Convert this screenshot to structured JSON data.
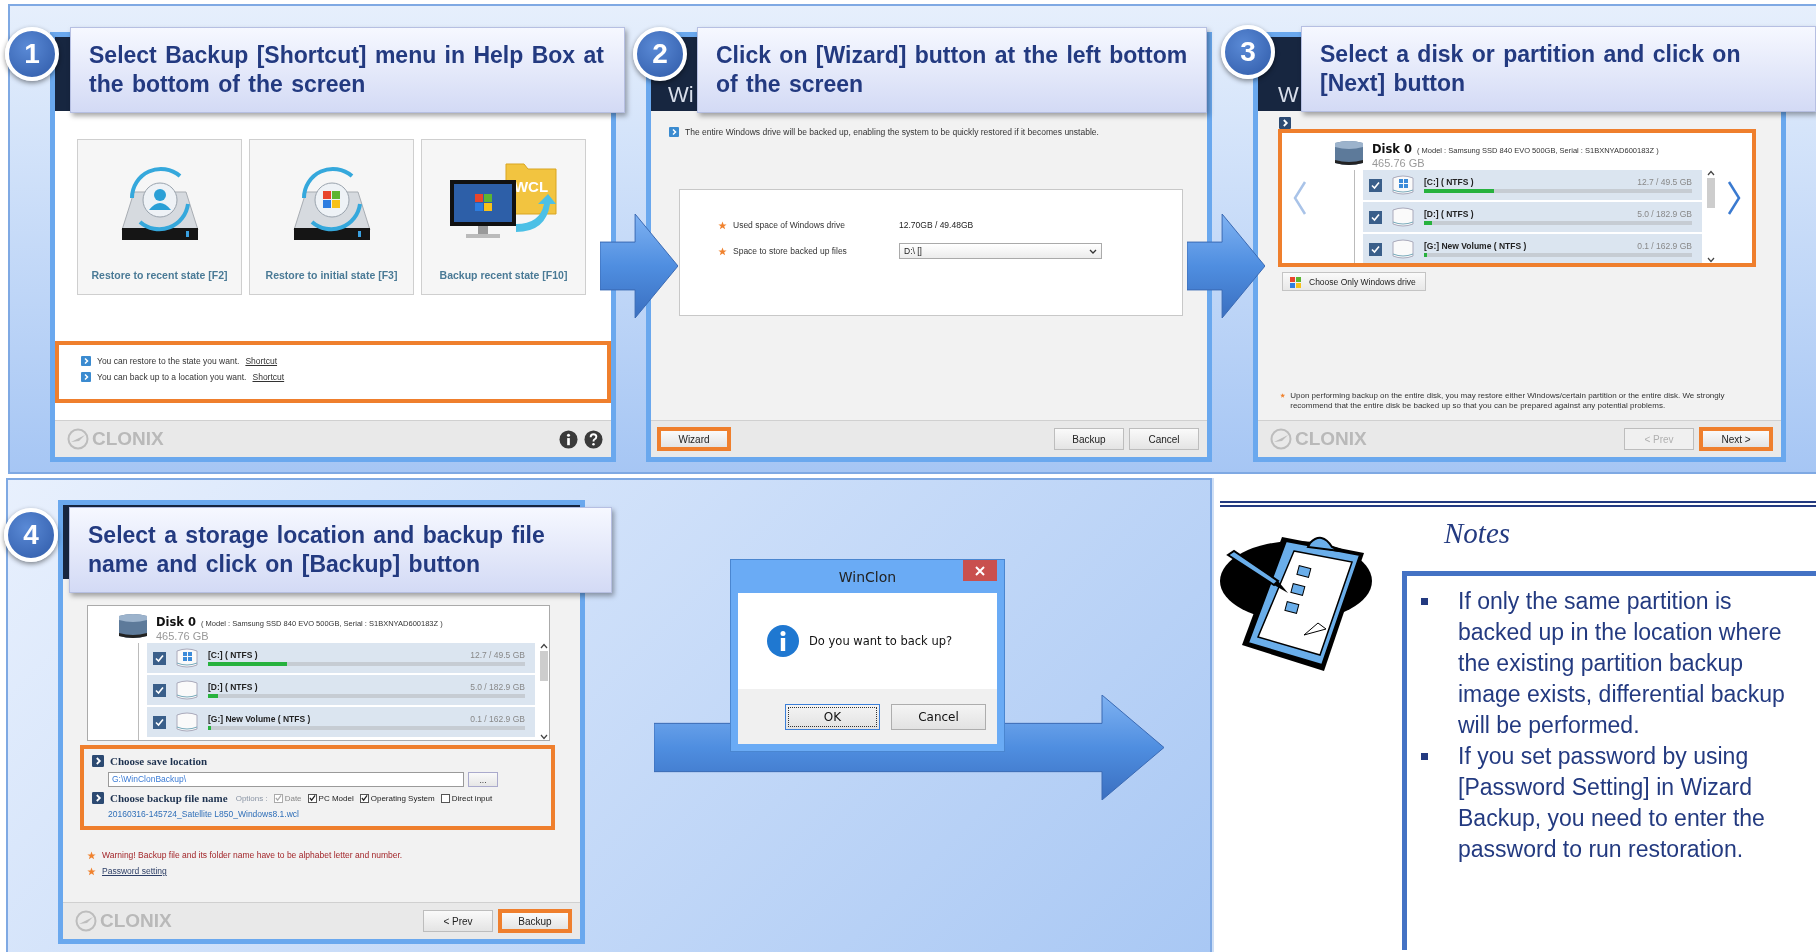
{
  "steps": [
    {
      "kind": "home",
      "number": "1",
      "instruction": "Select Backup [Shortcut] menu in Help Box at the bottom of the screen",
      "tiles": [
        {
          "kind": "recent",
          "label": "Restore to recent state [F2]"
        },
        {
          "kind": "initial",
          "label": "Restore to initial state [F3]"
        },
        {
          "kind": "backup",
          "label": "Backup recent state [F10]",
          "badge": "WCL"
        }
      ],
      "help_lines": [
        {
          "text": "You can restore to the state you want.",
          "link": "Shortcut"
        },
        {
          "text": "You can back up to a location you want.",
          "link": "Shortcut"
        }
      ],
      "help_highlighted": true,
      "logo": "CLONIX"
    },
    {
      "kind": "wizard",
      "number": "2",
      "instruction": "Click on [Wizard] button at the left bottom of the screen",
      "title_visible": "Wi",
      "info": "The entire Windows drive will be backed up, enabling the system to be quickly restored if it becomes unstable.",
      "fields": [
        {
          "kind": "text",
          "label": "Used space of Windows drive",
          "value": "12.70GB / 49.48GB"
        },
        {
          "kind": "dropdown",
          "label": "Space to store backed up files",
          "value": "D:\\ []"
        }
      ],
      "left_buttons": [
        {
          "label": "Wizard",
          "highlighted": true,
          "disabled": false
        }
      ],
      "right_buttons": [
        {
          "label": "Backup",
          "highlighted": false,
          "disabled": false
        },
        {
          "label": "Cancel",
          "highlighted": false,
          "disabled": false
        }
      ]
    },
    {
      "kind": "disk_select",
      "number": "3",
      "instruction": "Select a disk or partition and click on [Next] button",
      "title_visible": "W",
      "disk": {
        "name": "Disk 0",
        "details": "( Model : Samsung SSD 840 EVO 500GB, Serial : S1BXNYAD600183Z )",
        "size": "465.76 GB"
      },
      "partitions": [
        {
          "kind": "windows",
          "label": "[C:] ( NTFS )",
          "usage": "12.7 / 49.5 GB",
          "level": 0.26,
          "checked": true
        },
        {
          "kind": "drive",
          "label": "[D:] ( NTFS )",
          "usage": "5.0 / 182.9 GB",
          "level": 0.03,
          "checked": true
        },
        {
          "kind": "drive",
          "label": "[G:] New Volume ( NTFS )",
          "usage": "0.1 / 162.9 GB",
          "level": 0.01,
          "checked": true
        }
      ],
      "nav_arrows": true,
      "list_highlighted": true,
      "choose_button": "Choose Only Windows drive",
      "note": "Upon performing backup on the entire disk, you may restore either Windows/certain partition or the entire disk. We strongly recommend that the entire disk be backed up so that you can be prepared against any potential problems.",
      "logo": "CLONIX",
      "right_buttons": [
        {
          "label": "< Prev",
          "highlighted": false,
          "disabled": true
        },
        {
          "label": "Next >",
          "highlighted": true,
          "disabled": false
        }
      ]
    },
    {
      "kind": "save",
      "number": "4",
      "instruction": "Select a storage location and backup file name and click on [Backup] button",
      "disk": {
        "name": "Disk 0",
        "details": "( Model : Samsung SSD 840 EVO 500GB, Serial : S1BXNYAD600183Z )",
        "size": "465.76 GB"
      },
      "partitions": [
        {
          "kind": "windows",
          "label": "[C:] ( NTFS )",
          "usage": "12.7 / 49.5 GB",
          "level": 0.25,
          "checked": true
        },
        {
          "kind": "drive",
          "label": "[D:] ( NTFS )",
          "usage": "5.0 / 182.9 GB",
          "level": 0.03,
          "checked": true
        },
        {
          "kind": "drive",
          "label": "[G:] New Volume ( NTFS )",
          "usage": "0.1 / 162.9 GB",
          "level": 0.01,
          "checked": true
        }
      ],
      "nav_arrows": false,
      "save_location": {
        "label": "Choose save location",
        "path": "G:\\WinClonBackup\\",
        "browse": "..."
      },
      "file_name": {
        "label": "Choose backup file name",
        "options_label": "Options :",
        "options": [
          {
            "label": "Date",
            "checked": true,
            "disabled": true
          },
          {
            "label": "PC Model",
            "checked": true,
            "disabled": false
          },
          {
            "label": "Operating System",
            "checked": true,
            "disabled": false
          },
          {
            "label": "Direct input",
            "checked": false,
            "disabled": false
          }
        ],
        "value": "20160316-145724_Satellite L850_Windows8.1.wcl"
      },
      "section_highlighted": true,
      "warning": "Warning! Backup file and its folder name have to be alphabet letter and number.",
      "password_link": "Password setting",
      "logo": "CLONIX",
      "right_buttons": [
        {
          "label": "< Prev",
          "highlighted": false,
          "disabled": false
        },
        {
          "label": "Backup",
          "highlighted": true,
          "disabled": false
        }
      ]
    }
  ],
  "dialog": {
    "title": "WinClon",
    "message": "Do you want to back up?",
    "buttons": [
      {
        "label": "OK",
        "focused": true
      },
      {
        "label": "Cancel",
        "focused": false
      }
    ]
  },
  "notes": {
    "title": "Notes",
    "items": [
      "If only the same partition is backed up in the location where the existing partition backup image exists, differential backup will be performed.",
      "If you set password by using [Password Setting] in Wizard Backup, you need to enter the password to run restoration."
    ]
  }
}
